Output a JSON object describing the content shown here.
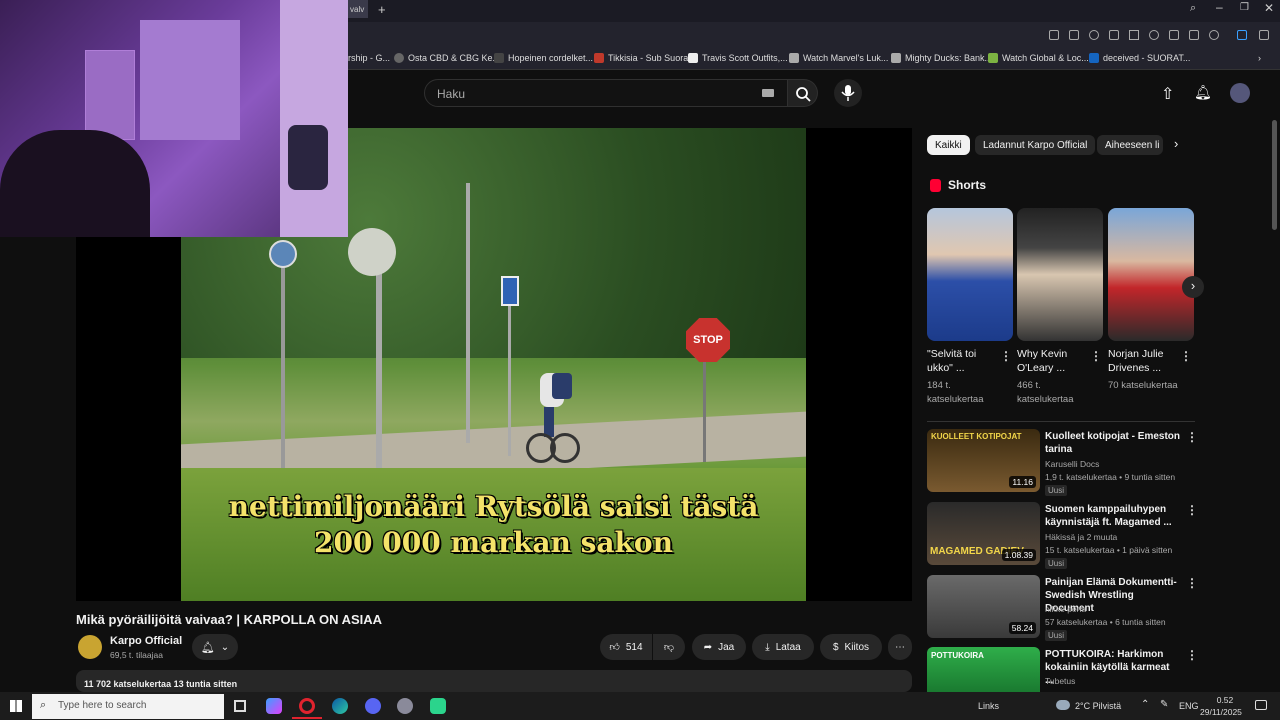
{
  "browser": {
    "tab_fragment": "valv",
    "bookmarks": [
      {
        "label": "rship - G...",
        "color": "#666"
      },
      {
        "label": "Osta CBD & CBG Ke...",
        "color": "#777"
      },
      {
        "label": "Hopeinen cordelket...",
        "color": "#444"
      },
      {
        "label": "Tikkisia - Sub Suora",
        "color": "#c0392b"
      },
      {
        "label": "Travis Scott Outfits,...",
        "color": "#eee"
      },
      {
        "label": "Watch Marvel's Luk...",
        "color": "#aaa"
      },
      {
        "label": "Mighty Ducks: Bank...",
        "color": "#aaa"
      },
      {
        "label": "Watch Global & Loc...",
        "color": "#7cb342"
      },
      {
        "label": "deceived - SUORAT...",
        "color": "#1565c0"
      }
    ]
  },
  "header": {
    "search_placeholder": "Haku"
  },
  "video": {
    "subtitle_line1": "nettimiljonääri Rytsölä saisi tästä",
    "subtitle_line2": "200 000 markan sakon",
    "sign_text": "STOP",
    "title": "Mikä pyöräilijöitä vaivaa? | KARPOLLA ON ASIAA",
    "channel_name": "Karpo Official",
    "subscribers": "69,5 t. tilaajaa",
    "likes": "514",
    "share_label": "Jaa",
    "download_label": "Lataa",
    "thanks_label": "Kiitos",
    "views_date": "11 702 katselukertaa  13 tuntia sitten"
  },
  "chips": [
    "Kaikki",
    "Ladannut Karpo Official",
    "Aiheeseen li"
  ],
  "shorts": {
    "heading": "Shorts",
    "items": [
      {
        "title": "\"Selvitä toi ukko\" ...",
        "views": "184 t. katselukertaa"
      },
      {
        "title": "Why Kevin O'Leary ...",
        "views": "466 t. katselukertaa"
      },
      {
        "title": "Norjan Julie Drivenes ...",
        "views": "70 katselukertaa"
      }
    ]
  },
  "recommendations": [
    {
      "title": "Kuolleet kotipojat - Emeston tarina",
      "channel": "Karuselli Docs",
      "meta": "1,9 t. katselukertaa • 9 tuntia sitten",
      "duration": "11.16",
      "badge": "Uusi",
      "thumb_text": "KUOLLEET KOTIPOJAT"
    },
    {
      "title": "Suomen kamppailuhypen käynnistäjä ft. Magamed ...",
      "channel": "Häkissä ja 2 muuta",
      "meta": "15 t. katselukertaa • 1 päivä sitten",
      "duration": "1.08.39",
      "badge": "Uusi",
      "thumb_text": "MAGAMED GADIEV"
    },
    {
      "title": "Painijan Elämä Dokumentti- Swedish Wrestling Document",
      "channel": "nikke pena",
      "meta": "57 katselukertaa • 6 tuntia sitten",
      "duration": "58.24",
      "badge": "Uusi",
      "thumb_text": ""
    },
    {
      "title": "POTTUKOIRA: Harkimon kokainiin käytöllä karmeat ...",
      "channel": "Tubetus",
      "meta": "",
      "duration": "",
      "badge": "",
      "thumb_text": "POTTUKOIRA"
    }
  ],
  "taskbar": {
    "search_placeholder": "Type here to search",
    "links_label": "Links",
    "weather": "2°C  Pilvistä",
    "language": "ENG",
    "time": "0.52",
    "date": "29/11/2025"
  }
}
